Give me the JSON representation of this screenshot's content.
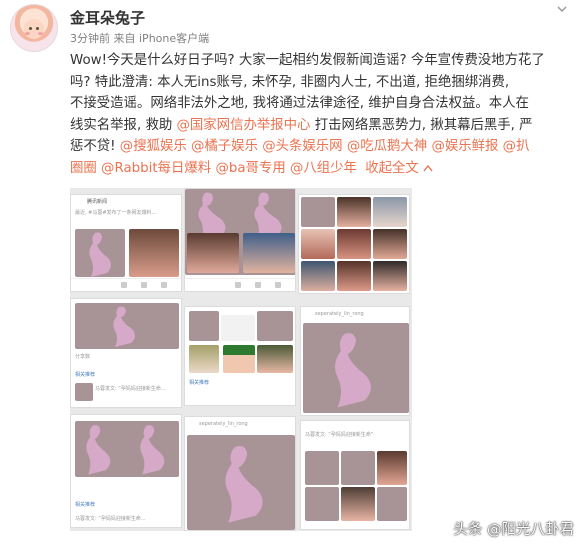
{
  "post": {
    "username": "金耳朵兔子",
    "time": "3分钟前",
    "source_prefix": "来自",
    "source": "iPhone客户端",
    "text_lines": [
      "Wow!今天是什么好日子吗? 大家一起相约发假新闻造谣? 今年宣传费没地方花了",
      "吗? 特此澄清: 本人无ins账号, 未怀孕, 非圈内人士, 不出道, 拒绝捆绑消费,",
      "不接受造谣。网络非法外之地, 我将通过法律途径, 维护自身合法权益。本人在",
      "线实名举报, 救助"
    ],
    "report_link": "@国家网信办举报中心",
    "after_report": " 打击网络黑恶势力, 揪其幕后黑手, 严",
    "line5_prefix": "惩不贷! ",
    "mentions_line5": [
      "@搜狐娱乐",
      "@橘子娱乐",
      "@头条娱乐网",
      "@吃瓜鹅大神",
      "@娱乐鲜报",
      "@扒"
    ],
    "mentions_line6": [
      "圈圈",
      "@Rabbit每日爆料",
      "@ba哥专用",
      "@八组少年"
    ],
    "collapse_label": "收起全文"
  },
  "collage": {
    "panel_texts": [
      "腾讯新闻",
      "最近, #马蓉#发布了一条网友爆料...",
      "分享数",
      "马蓉发文: “孕妈妈迎接新生命...",
      "相关推荐",
      "seperately_lin_rong",
      "马蓉发文: “孕妈妈迎接新生命”"
    ]
  },
  "watermark": "头条 @阳光八卦君",
  "colors": {
    "link": "#eb7350",
    "silhouette": "#d6a9c8",
    "lace_bg": "#a89496",
    "text": "#333333",
    "meta": "#808080"
  }
}
